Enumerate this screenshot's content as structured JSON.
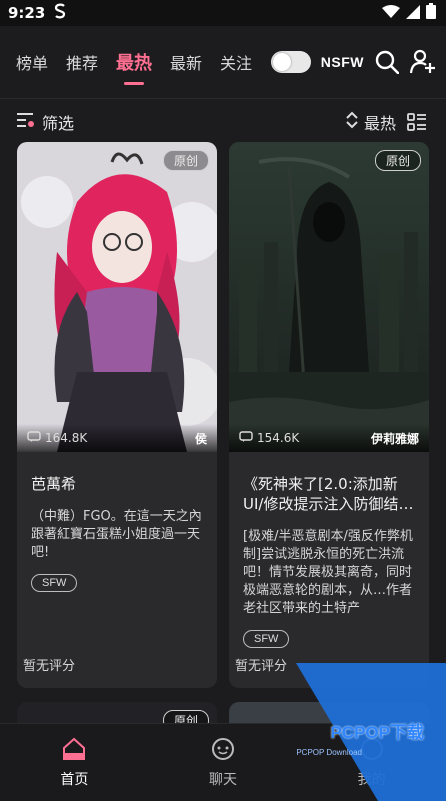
{
  "status": {
    "time": "9:23"
  },
  "nav": {
    "tabs": [
      "榜单",
      "推荐",
      "最热",
      "最新",
      "关注"
    ],
    "active_tab": "最热",
    "nsfw_label": "NSFW"
  },
  "filter": {
    "filter_label": "筛选",
    "sort_label": "最热"
  },
  "cards": [
    {
      "badge": "原创",
      "views": "164.8K",
      "author": "侯",
      "title": "芭萬希",
      "desc": "（中難）FGO。在這一天之內跟著紅寶石蛋糕小姐度過一天吧!",
      "tag": "SFW",
      "rating": "暂无评分"
    },
    {
      "badge": "原创",
      "views": "154.6K",
      "author": "伊莉雅娜",
      "title": "《死神来了[2.0:添加新UI/修改提示注入防御结…",
      "desc": "[极难/半恶意剧本/强反作弊机制]尝试逃脱永恒的死亡洪流吧！情节发展极其离奇，同时极端恶意轮的剧本，从…作者老社区带来的土特产",
      "tag": "SFW",
      "rating": "暂无评分"
    }
  ],
  "cards_row2": [
    {
      "badge": "原创"
    }
  ],
  "bottom_nav": [
    {
      "label": "首页",
      "icon": "home-icon"
    },
    {
      "label": "聊天",
      "icon": "chat-icon"
    },
    {
      "label": "我的",
      "icon": "profile-icon"
    }
  ],
  "watermark": {
    "brand": "PCPOP下载",
    "sub": "PCPOP Download"
  },
  "colors": {
    "accent": "#ff6f91",
    "background": "#1c1c1e",
    "card": "#2a2a2d",
    "watermark": "#1e6fd6"
  }
}
